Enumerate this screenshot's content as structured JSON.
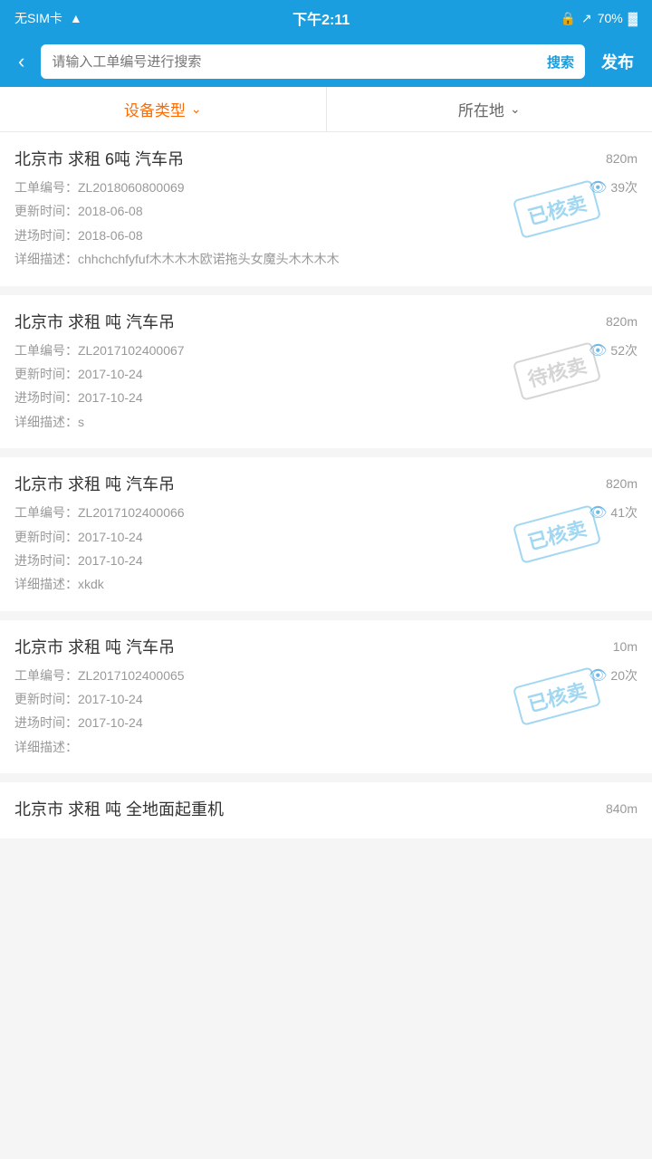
{
  "statusBar": {
    "left": "无SIM卡 ▲",
    "center": "下午2:11",
    "right": "70%"
  },
  "header": {
    "backLabel": "‹",
    "searchPlaceholder": "请输入工单编号进行搜索",
    "searchBtnLabel": "搜索",
    "publishLabel": "发布"
  },
  "filter": {
    "type": {
      "label": "设备类型",
      "active": true
    },
    "location": {
      "label": "所在地",
      "active": false
    }
  },
  "items": [
    {
      "title": "北京市 求租 6吨 汽车吊",
      "distance": "820m",
      "orderNo": "工单编号：ZL2018060800069",
      "views": "39次",
      "updateTime": "更新时间：2018-06-08",
      "entryTime": "进场时间：2018-06-08",
      "description": "详细描述：chhchchfyfuf木木木木欧诺拖头女魔头木木木木",
      "stamp": "已核卖",
      "stampType": "sold"
    },
    {
      "title": "北京市 求租 吨 汽车吊",
      "distance": "820m",
      "orderNo": "工单编号：ZL2017102400067",
      "views": "52次",
      "updateTime": "更新时间：2017-10-24",
      "entryTime": "进场时间：2017-10-24",
      "description": "详细描述：s",
      "stamp": "待核卖",
      "stampType": "pending"
    },
    {
      "title": "北京市 求租 吨 汽车吊",
      "distance": "820m",
      "orderNo": "工单编号：ZL2017102400066",
      "views": "41次",
      "updateTime": "更新时间：2017-10-24",
      "entryTime": "进场时间：2017-10-24",
      "description": "详细描述：xkdk",
      "stamp": "已核卖",
      "stampType": "sold"
    },
    {
      "title": "北京市 求租 吨 汽车吊",
      "distance": "10m",
      "orderNo": "工单编号：ZL2017102400065",
      "views": "20次",
      "updateTime": "更新时间：2017-10-24",
      "entryTime": "进场时间：2017-10-24",
      "description": "详细描述：",
      "stamp": "已核卖",
      "stampType": "sold"
    }
  ],
  "partialItem": {
    "title": "北京市 求租 吨 全地面起重机",
    "distance": "840m"
  }
}
